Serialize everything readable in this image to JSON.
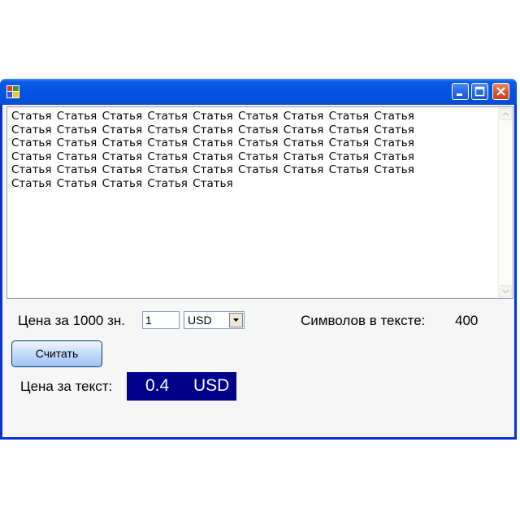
{
  "window": {
    "title": "",
    "icon": "windows-app-icon",
    "buttons": [
      "minimize-icon",
      "maximize-icon",
      "close-icon"
    ]
  },
  "text_area": {
    "content": "Статья Статья Статья Статья Статья Статья Статья Статья Статья\nСтатья Статья Статья Статья Статья Статья Статья Статья Статья\nСтатья Статья Статья Статья Статья Статья Статья Статья Статья\nСтатья Статья Статья Статья Статья Статья Статья Статья Статья\nСтатья Статья Статья Статья Статья Статья Статья Статья Статья\nСтатья Статья Статья Статья Статья"
  },
  "form": {
    "price_label": "Цена за 1000 зн.",
    "price_value": "1",
    "currency_selected": "USD",
    "char_count_label": "Символов в тексте:",
    "char_count_value": "400",
    "calc_button": "Считать",
    "result_label": "Цена за текст:",
    "result_value": "0.4",
    "result_currency": "USD"
  },
  "colors": {
    "titlebar": "#0454e2",
    "result_bg": "#00008b",
    "result_fg": "#ffffff"
  }
}
